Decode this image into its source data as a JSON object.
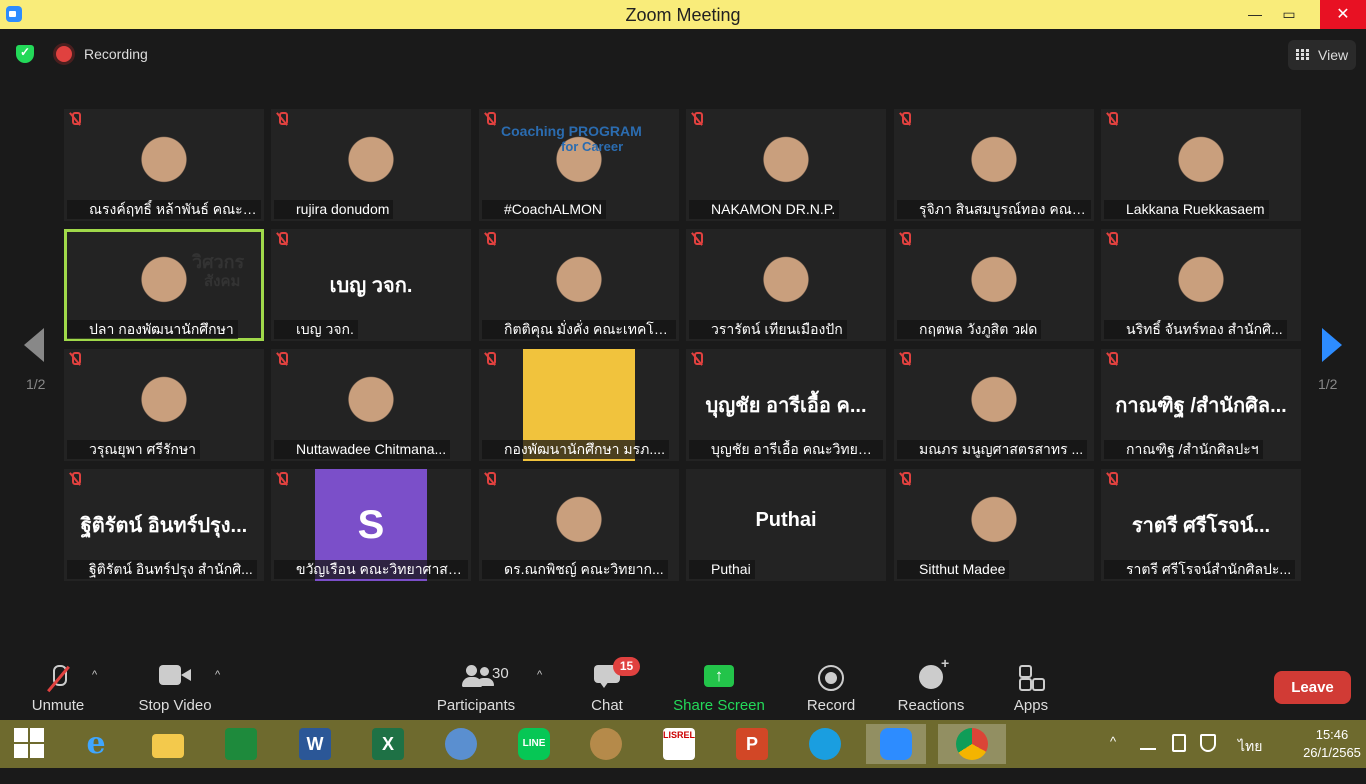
{
  "window": {
    "title": "Zoom Meeting",
    "minimize": "—",
    "maximize": "▭",
    "close": "✕"
  },
  "meeting": {
    "recording_label": "Recording",
    "view_label": "View",
    "page_left": "1/2",
    "page_right": "1/2"
  },
  "tiles": [
    {
      "name": "ณรงค์ฤทธิ์ หล้าพันธ์ คณะว..."
    },
    {
      "name": "rujira donudom"
    },
    {
      "name": "#CoachALMON"
    },
    {
      "name": "NAKAMON DR.N.P."
    },
    {
      "name": "รุจิภา สินสมบูรณ์ทอง คณะ..."
    },
    {
      "name": "Lakkana Ruekkasaem"
    },
    {
      "name": "ปลา กองพัฒนานักศึกษา"
    },
    {
      "name": "เบญ วจก.",
      "big": "เบญ วจก."
    },
    {
      "name": "กิตติคุณ มั่งคั่ง คณะเทคโนโ..."
    },
    {
      "name": "วรารัตน์ เทียนเมืองปัก"
    },
    {
      "name": "กฤตพล วังภูสิต วฝด"
    },
    {
      "name": "นริทธิ์ จันทร์ทอง สำนักศิ..."
    },
    {
      "name": "วรุณยุพา ศรีรักษา"
    },
    {
      "name": "Nuttawadee Chitmana..."
    },
    {
      "name": "กองพัฒนานักศึกษา มรภ...."
    },
    {
      "name": "บุญชัย อารีเอื้อ คณะวิทยาศ...",
      "big": "บุญชัย อารีเอื้อ ค..."
    },
    {
      "name": "มณภร มนูญศาสตรสาทร ..."
    },
    {
      "name": "กาณฑิฐ /สำนักศิลปะฯ",
      "big": "กาณฑิฐ /สำนักศิล..."
    },
    {
      "name": "ฐิติรัตน์ อินทร์ปรุง สำนักศิ...",
      "big": "ฐิติรัตน์ อินทร์ปรุง..."
    },
    {
      "name": "ขวัญเรือน คณะวิทยาศาสต...",
      "avatar": "S"
    },
    {
      "name": "ดร.ณกพิชญ์ คณะวิทยาก..."
    },
    {
      "name": "Puthai",
      "big": "Puthai"
    },
    {
      "name": "Sitthut Madee"
    },
    {
      "name": "ราตรี  ศรีโรจน์สำนักศิลปะ...",
      "big": "ราตรี  ศรีโรจน์..."
    }
  ],
  "tile_overlays": {
    "coach_banner": "Coaching PROGRAM",
    "coach_banner2": "for Career",
    "brand_text_1": "วิศวกร",
    "brand_text_2": "สังคม"
  },
  "toolbar": {
    "unmute": "Unmute",
    "stop_video": "Stop Video",
    "participants": "Participants",
    "participants_count": "30",
    "chat": "Chat",
    "chat_badge": "15",
    "share_screen": "Share Screen",
    "record": "Record",
    "reactions": "Reactions",
    "apps": "Apps",
    "leave": "Leave",
    "caret": "^"
  },
  "taskbar": {
    "apps": [
      "internet-explorer",
      "file-explorer",
      "store",
      "word",
      "excel",
      "math-input",
      "line",
      "paint",
      "lisrel",
      "powerpoint",
      "edge",
      "zoom",
      "chrome"
    ],
    "word_glyph": "W",
    "excel_glyph": "X",
    "ppt_glyph": "P",
    "line_glyph": "LINE",
    "ie_glyph": "e",
    "lisrel_glyph": "LISREL",
    "tray_up": "^",
    "language": "ไทย",
    "time": "15:46",
    "date": "26/1/2565"
  },
  "colors": {
    "titlebar": "#f9ec7a",
    "accent_blue": "#2d8cff",
    "leave_red": "#d13b35",
    "share_green": "#23c44a",
    "taskbar": "#6e6a2e"
  }
}
